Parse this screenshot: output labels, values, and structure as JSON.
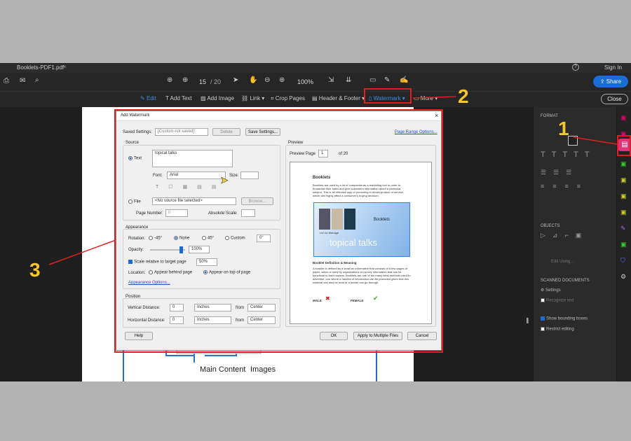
{
  "window": {
    "tab_title": "Booklets-PDF1.pdf",
    "tab_close": "×",
    "sign_in": "Sign In",
    "help": "?"
  },
  "toolbar": {
    "page_current": "15",
    "page_total": "/ 20",
    "zoom": "100%",
    "share_label": "Share",
    "close_label": "Close"
  },
  "edit_toolbar": {
    "edit": "Edit",
    "add_text": "Add Text",
    "add_image": "Add Image",
    "link": "Link ▾",
    "crop": "Crop Pages",
    "header_footer": "Header & Footer ▾",
    "watermark": "Watermark ▾",
    "more": "More ▾"
  },
  "right_panel": {
    "format": "FORMAT",
    "objects": "OBJECTS",
    "edit_using": "Edit Using...",
    "scanned": "SCANNED DOCUMENTS",
    "settings": "Settings",
    "recognize": "Recognize text",
    "show_bbox": "Show bounding boxes",
    "restrict": "Restrict editing"
  },
  "doc": {
    "main_content": "Main Content",
    "images": "Images"
  },
  "dialog": {
    "title": "Add Watermark",
    "close": "×",
    "saved_settings_label": "Saved Settings:",
    "saved_settings_value": "[Custom-not saved]",
    "delete": "Delete",
    "save_settings": "Save Settings...",
    "page_range": "Page Range Options...",
    "source": {
      "header": "Source",
      "text_label": "Text",
      "text_value": "topical talks",
      "font_label": "Font:",
      "font_value": "Arial",
      "size_label": "Size:",
      "file_label": "File",
      "file_value": "<No source file selected>",
      "browse": "Browse...",
      "page_number_label": "Page Number:",
      "page_number_value": "0",
      "abs_scale_label": "Absolute Scale:"
    },
    "appearance": {
      "header": "Appearance",
      "rotation_label": "Rotation:",
      "rot_m45": "-45°",
      "rot_none": "None",
      "rot_45": "45°",
      "rot_custom": "Custom",
      "rot_custom_value": "0°",
      "opacity_label": "Opacity:",
      "opacity_value": "100%",
      "opacity_level": 1.0,
      "scale_label": "Scale relative to target page",
      "scale_value": "50%",
      "location_label": "Location:",
      "behind": "Appear behind page",
      "on_top": "Appear on top of page",
      "options_link": "Appearance Options..."
    },
    "position": {
      "header": "Position",
      "vertical_label": "Vertical Distance:",
      "vertical_value": "0",
      "vertical_unit": "Inches",
      "vertical_from_label": "from",
      "vertical_from": "Center",
      "horizontal_label": "Horizontal Distance:",
      "horizontal_value": "0",
      "horizontal_unit": "Inches",
      "horizontal_from_label": "from",
      "horizontal_from": "Center"
    },
    "preview": {
      "header": "Preview",
      "page_label": "Preview Page",
      "page_value": "1",
      "page_of": "of 20",
      "doc_title": "Booklets",
      "doc_para1": "Booklets are used by a lot of companies as a marketing tool to order to broadcast their sales and give customers information about a particular subject. This is an effective way of promoting a certain product or service, which can highly affect a consumer's buying decision.",
      "banner_text": "Booklets",
      "banner_small": "Let Us Manage",
      "watermark_text": "topical talks",
      "section_title": "Booklet Definition & Meaning",
      "doc_para2": "A booklet is defined as a small an informative that consists of a few pages of paper, which is used by organizations to convey information that can be beneficial to their readers. Booklets are one of the many ideal methods used to advertise, one where a handful of information can be promoted given that this material can also be read at a reader can go through.",
      "male": "MALE",
      "female": "FEMALE"
    },
    "help": "Help",
    "ok": "OK",
    "apply_multi": "Apply to Multiple Files",
    "cancel": "Cancel"
  },
  "annotations": {
    "one": "1",
    "two": "2",
    "three": "3"
  },
  "colors": {
    "accent": "#1a6bd3",
    "annotation": "#f4c72d",
    "highlight_red": "#e02020",
    "pink_rail": "#e0337a"
  }
}
